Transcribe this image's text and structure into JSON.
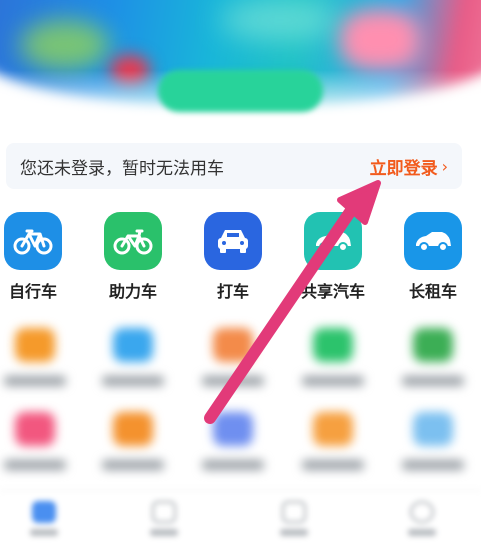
{
  "login_bar": {
    "message": "您还未登录，暂时无法用车",
    "login_label": "立即登录",
    "chevron": "›"
  },
  "services": [
    {
      "label": "自行车",
      "icon": "bicycle-icon",
      "color": "#1e8fe6"
    },
    {
      "label": "助力车",
      "icon": "e-bike-icon",
      "color": "#2ac16b"
    },
    {
      "label": "打车",
      "icon": "taxi-car-icon",
      "color": "#2a66e0"
    },
    {
      "label": "共享汽车",
      "icon": "shared-car-icon",
      "color": "#22c2b2"
    },
    {
      "label": "长租车",
      "icon": "rental-car-icon",
      "color": "#1996e8"
    }
  ],
  "colors": {
    "accent": "#f25b1d",
    "arrow": "#e23a79"
  }
}
